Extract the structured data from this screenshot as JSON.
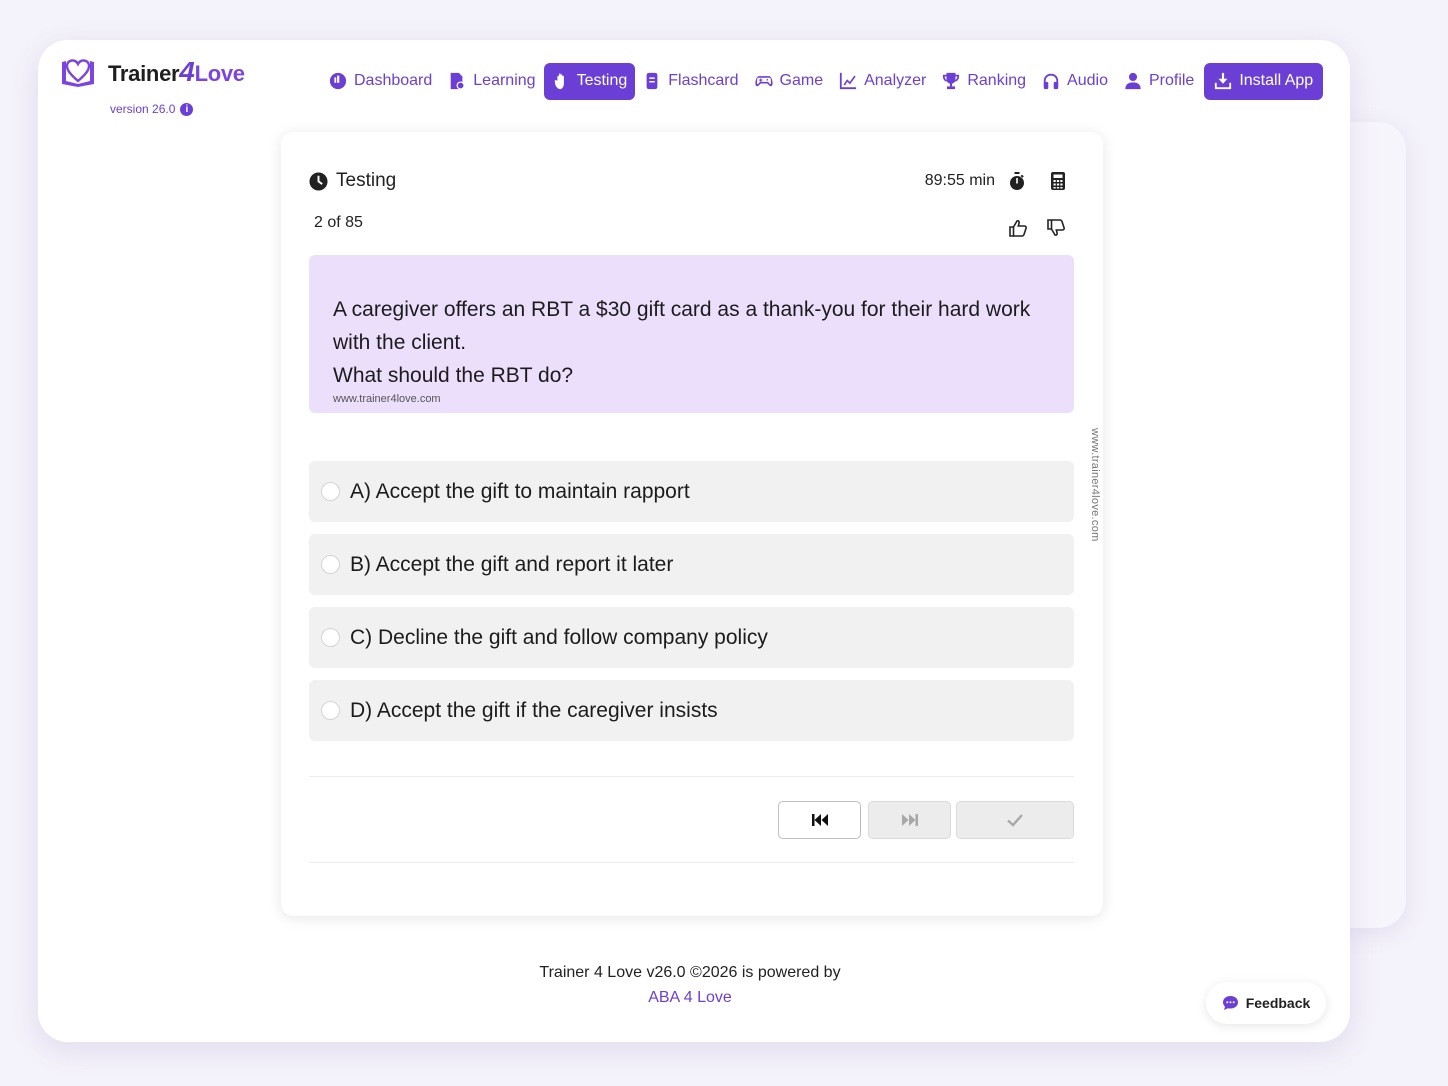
{
  "brand": {
    "name_prefix": "Trainer",
    "name_number": "4",
    "name_suffix": "Love",
    "version": "version 26.0",
    "info_icon": "i"
  },
  "nav": {
    "items": [
      {
        "label": "Dashboard",
        "icon": "dashboard-icon"
      },
      {
        "label": "Learning",
        "icon": "learning-icon"
      },
      {
        "label": "Testing",
        "icon": "testing-icon",
        "active": true
      },
      {
        "label": "Flashcard",
        "icon": "flashcard-icon"
      },
      {
        "label": "Game",
        "icon": "gamepad-icon"
      },
      {
        "label": "Analyzer",
        "icon": "chart-line-icon"
      },
      {
        "label": "Ranking",
        "icon": "trophy-icon"
      },
      {
        "label": "Audio",
        "icon": "headphones-icon"
      },
      {
        "label": "Profile",
        "icon": "user-icon"
      }
    ],
    "install_label": "Install App"
  },
  "quiz": {
    "title": "Testing",
    "timer": "89:55 min",
    "progress": "2 of 85",
    "question_line1": "A caregiver offers an RBT a $30 gift card as a thank-you for their hard work with the client.",
    "question_line2": "What should the RBT do?",
    "watermark": "www.trainer4love.com",
    "side_watermark": "www.trainer4love.com",
    "options": [
      "A) Accept the gift to maintain rapport",
      "B) Accept the gift and report it later",
      "C) Decline the gift and follow company policy",
      "D) Accept the gift if the caregiver insists"
    ]
  },
  "footer": {
    "text": "Trainer 4 Love v26.0 ©2026 is powered by",
    "link": "ABA 4 Love"
  },
  "feedback": {
    "label": "Feedback"
  },
  "colors": {
    "accent": "#6b3fd6",
    "question_bg": "#ecdffb",
    "option_bg": "#f1f1f1",
    "page_bg": "#f4f2fa"
  }
}
